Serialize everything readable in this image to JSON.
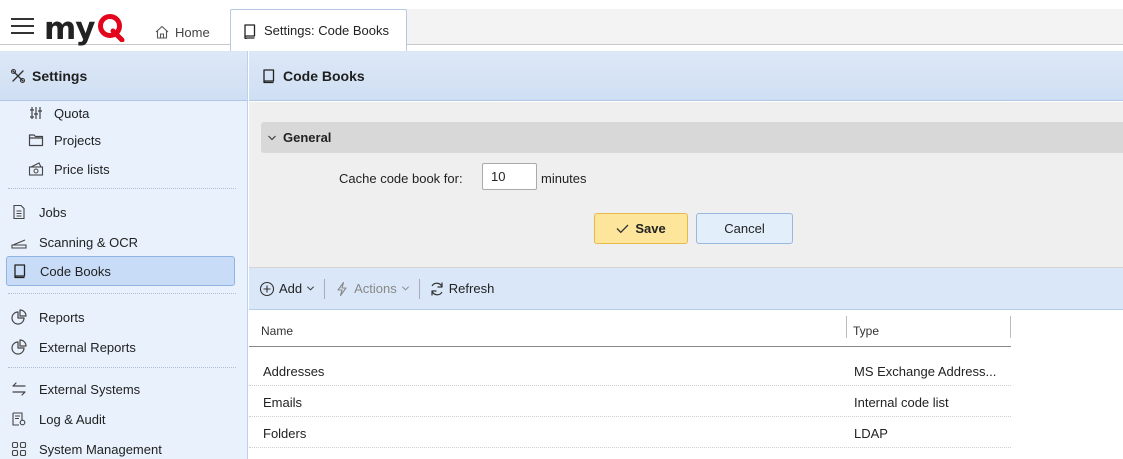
{
  "app": {
    "logo_text": "my",
    "logo_accent": "#e3051b"
  },
  "tabs": {
    "home_label": "Home",
    "active_label": "Settings: Code Books"
  },
  "sidebar": {
    "title": "Settings",
    "items": [
      {
        "label": "Quota",
        "icon": "quota-icon"
      },
      {
        "label": "Projects",
        "icon": "folder-icon"
      },
      {
        "label": "Price lists",
        "icon": "price-list-icon"
      },
      {
        "label": "Jobs",
        "icon": "document-icon"
      },
      {
        "label": "Scanning & OCR",
        "icon": "scanner-icon"
      },
      {
        "label": "Code Books",
        "icon": "book-icon",
        "active": true
      },
      {
        "label": "Reports",
        "icon": "pie-chart-icon"
      },
      {
        "label": "External Reports",
        "icon": "pie-chart-icon"
      },
      {
        "label": "External Systems",
        "icon": "arrows-exchange-icon"
      },
      {
        "label": "Log & Audit",
        "icon": "log-audit-icon"
      },
      {
        "label": "System Management",
        "icon": "grid-icon"
      }
    ]
  },
  "main": {
    "title": "Code Books",
    "section": {
      "title": "General"
    },
    "cache_field": {
      "label": "Cache code book for:",
      "value": "10",
      "unit": "minutes"
    },
    "save_label": "Save",
    "cancel_label": "Cancel"
  },
  "toolbar": {
    "add_label": "Add",
    "actions_label": "Actions",
    "refresh_label": "Refresh"
  },
  "table": {
    "columns": [
      "Name",
      "Type"
    ],
    "rows": [
      {
        "name": "Addresses",
        "type": "MS Exchange Address..."
      },
      {
        "name": "Emails",
        "type": "Internal code list"
      },
      {
        "name": "Folders",
        "type": "LDAP"
      }
    ]
  },
  "colors": {
    "accent": "#e3051b",
    "save_bg": "#fde59c",
    "panel_bg": "#e8f1fc",
    "header_bg": "#d3e2f5"
  }
}
